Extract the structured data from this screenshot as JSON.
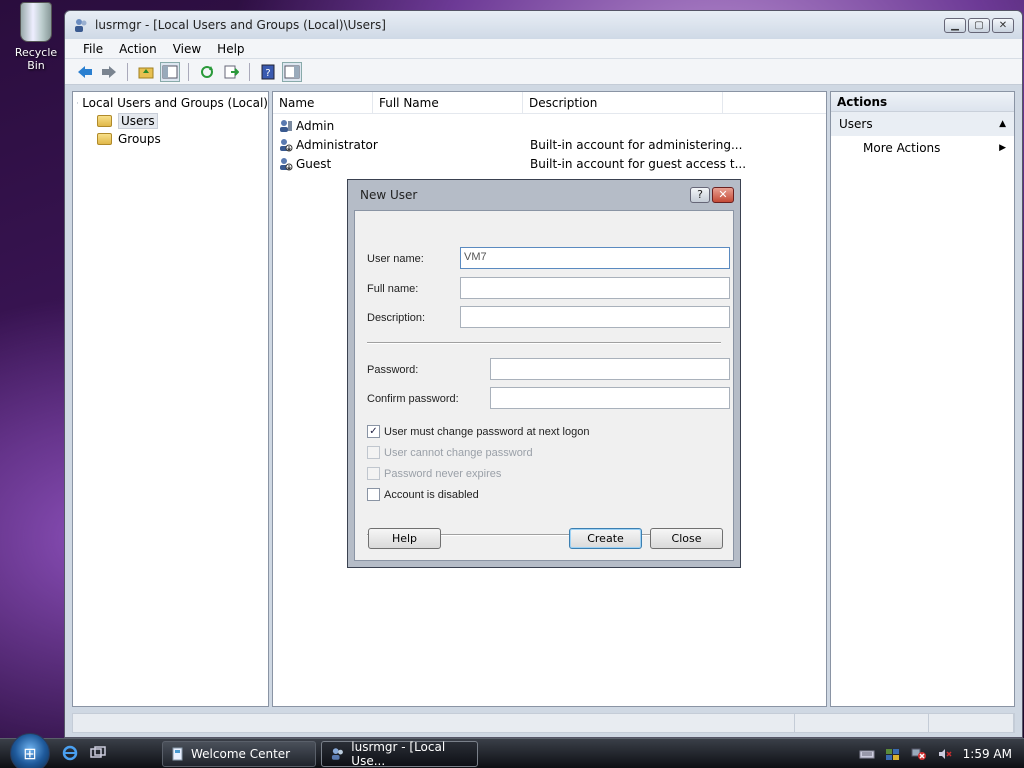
{
  "desktop": {
    "recycle_bin_label": "Recycle Bin"
  },
  "window": {
    "title": "lusrmgr - [Local Users and Groups (Local)\\Users]",
    "menu": [
      "File",
      "Action",
      "View",
      "Help"
    ]
  },
  "tree": {
    "root": "Local Users and Groups (Local)",
    "children": [
      "Users",
      "Groups"
    ],
    "selected": "Users"
  },
  "list": {
    "columns": [
      "Name",
      "Full Name",
      "Description"
    ],
    "rows": [
      {
        "name": "Admin",
        "full_name": "",
        "description": ""
      },
      {
        "name": "Administrator",
        "full_name": "",
        "description": "Built-in account for administering..."
      },
      {
        "name": "Guest",
        "full_name": "",
        "description": "Built-in account for guest access t..."
      }
    ]
  },
  "actions": {
    "header": "Actions",
    "section": "Users",
    "items": [
      "More Actions"
    ]
  },
  "dialog": {
    "title": "New User",
    "help_glyph": "?",
    "close_glyph": "✕",
    "fields": {
      "user_name_label": "User name:",
      "user_name_value": "VM7",
      "full_name_label": "Full name:",
      "full_name_value": "",
      "description_label": "Description:",
      "description_value": "",
      "password_label": "Password:",
      "confirm_label": "Confirm password:"
    },
    "checkboxes": {
      "must_change_label": "User must change password at next logon",
      "must_change_checked": true,
      "cannot_change_label": "User cannot change password",
      "cannot_change_checked": false,
      "never_expires_label": "Password never expires",
      "never_expires_checked": false,
      "disabled_label": "Account is disabled",
      "disabled_checked": false
    },
    "buttons": {
      "help": "Help",
      "create": "Create",
      "close": "Close"
    }
  },
  "taskbar": {
    "start_glyph": "⊞",
    "tasks": [
      {
        "label": "Welcome Center",
        "active": false
      },
      {
        "label": "lusrmgr - [Local Use...",
        "active": true
      }
    ],
    "clock": "1:59 AM"
  },
  "colors": {
    "accent": "#3c7fb1",
    "close_red": "#c44a36"
  }
}
